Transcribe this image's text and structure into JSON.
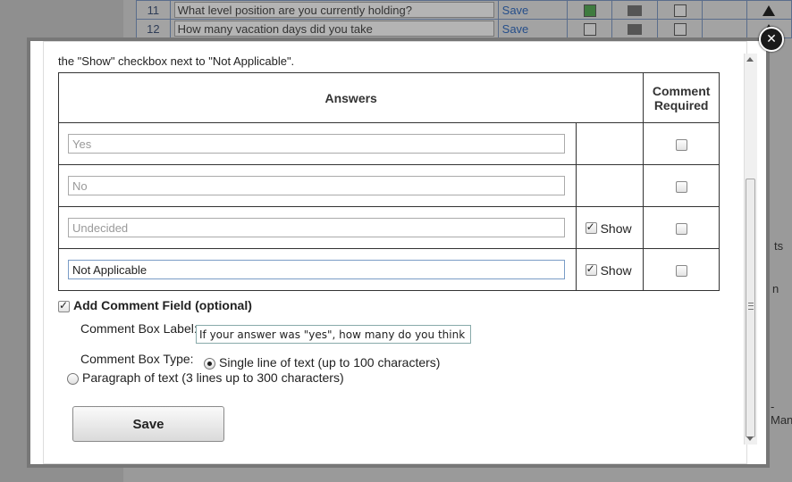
{
  "background": {
    "rows": [
      {
        "num": "11",
        "question": "What level position are you currently holding?",
        "save": "Save"
      },
      {
        "num": "12",
        "question": "How many vacation days did you take",
        "save": "Save"
      }
    ],
    "right_fragments": [
      "ts",
      "n",
      "-Man"
    ]
  },
  "modal": {
    "intro": "the \"Show\" checkbox next to \"Not Applicable\".",
    "headers": {
      "answers": "Answers",
      "comment_required": "Comment Required"
    },
    "answers": [
      {
        "value": "Yes",
        "has_show": false,
        "show_checked": false,
        "comment_required": false,
        "active": false
      },
      {
        "value": "No",
        "has_show": false,
        "show_checked": false,
        "comment_required": false,
        "active": false
      },
      {
        "value": "Undecided",
        "has_show": true,
        "show_checked": true,
        "comment_required": false,
        "active": false
      },
      {
        "value": "Not Applicable",
        "has_show": true,
        "show_checked": true,
        "comment_required": false,
        "active": true
      }
    ],
    "show_label": "Show",
    "add_comment_label": "Add Comment Field (optional)",
    "add_comment_checked": true,
    "comment_box_label_text": "Comment Box Label:",
    "comment_box_label_value": "If your answer was \"yes\", how many do you think th",
    "comment_box_type_text": "Comment Box Type:",
    "type_options": [
      {
        "label": "Single line of text (up to 100 characters)",
        "checked": true
      },
      {
        "label": "Paragraph of text (3 lines up to 300 characters)",
        "checked": false
      }
    ],
    "save_label": "Save",
    "close_glyph": "✕"
  }
}
